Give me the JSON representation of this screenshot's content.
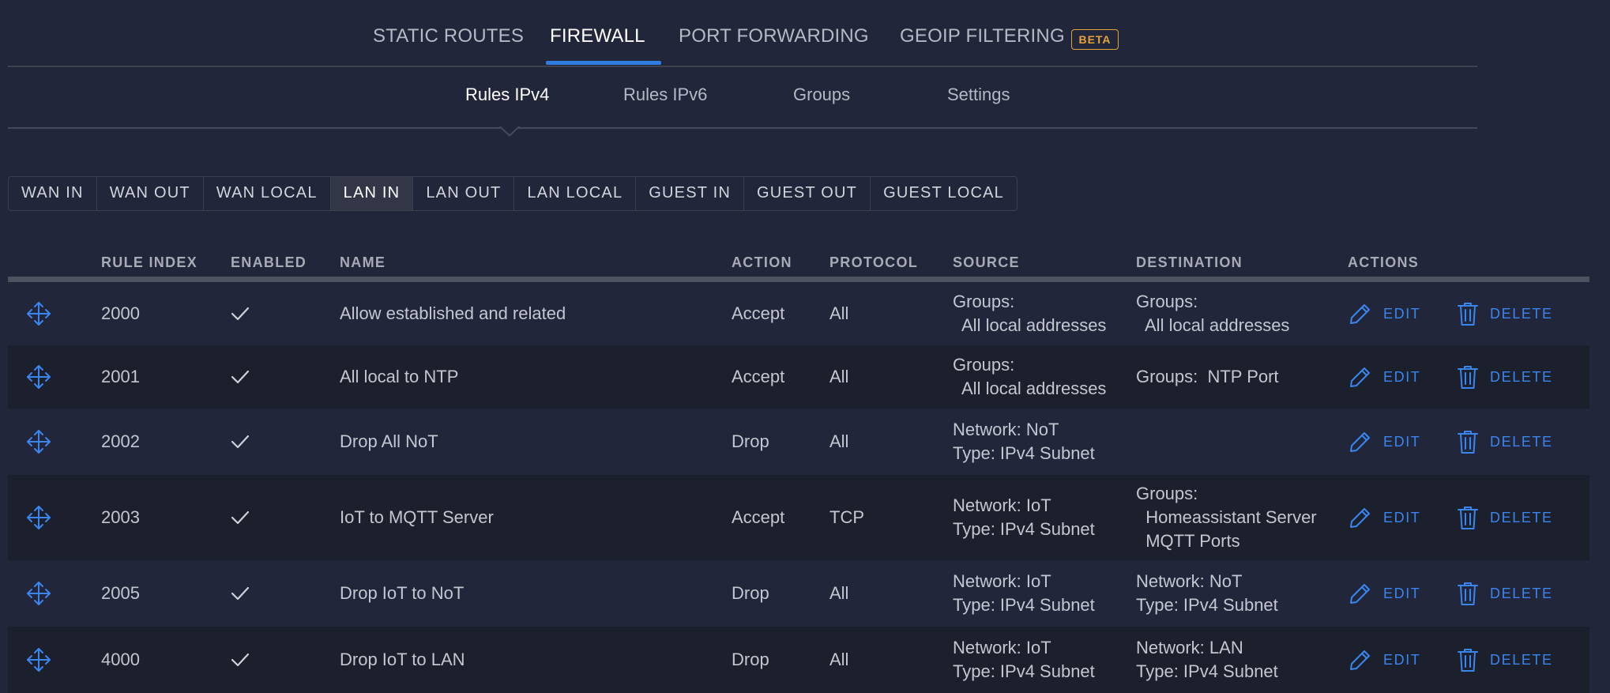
{
  "top_tabs": [
    {
      "label": "STATIC ROUTES",
      "active": false
    },
    {
      "label": "FIREWALL",
      "active": true
    },
    {
      "label": "PORT FORWARDING",
      "active": false
    },
    {
      "label": "GEOIP FILTERING",
      "active": false
    }
  ],
  "beta_badge": "BETA",
  "sub_tabs": [
    {
      "label": "Rules IPv4",
      "active": true
    },
    {
      "label": "Rules IPv6",
      "active": false
    },
    {
      "label": "Groups",
      "active": false
    },
    {
      "label": "Settings",
      "active": false
    }
  ],
  "rulesets": [
    "WAN IN",
    "WAN OUT",
    "WAN LOCAL",
    "LAN IN",
    "LAN OUT",
    "LAN LOCAL",
    "GUEST IN",
    "GUEST OUT",
    "GUEST LOCAL"
  ],
  "active_ruleset": "LAN IN",
  "columns": {
    "rule_index": "RULE INDEX",
    "enabled": "ENABLED",
    "name": "NAME",
    "action": "ACTION",
    "protocol": "PROTOCOL",
    "source": "SOURCE",
    "destination": "DESTINATION",
    "actions": "ACTIONS"
  },
  "action_labels": {
    "edit": "EDIT",
    "delete": "DELETE"
  },
  "rules": [
    {
      "index": "2000",
      "enabled": true,
      "name": "Allow established and related",
      "action": "Accept",
      "protocol": "All",
      "source": [
        "Groups:",
        "  All local addresses"
      ],
      "destination": [
        "Groups:",
        "  All local addresses"
      ]
    },
    {
      "index": "2001",
      "enabled": true,
      "name": "All local to NTP",
      "action": "Accept",
      "protocol": "All",
      "source": [
        "Groups:",
        "  All local addresses"
      ],
      "destination": [
        "Groups:  NTP Port"
      ]
    },
    {
      "index": "2002",
      "enabled": true,
      "name": "Drop All NoT",
      "action": "Drop",
      "protocol": "All",
      "source": [
        "Network: NoT",
        "Type: IPv4 Subnet"
      ],
      "destination": []
    },
    {
      "index": "2003",
      "enabled": true,
      "name": "IoT to MQTT Server",
      "action": "Accept",
      "protocol": "TCP",
      "source": [
        "Network: IoT",
        "Type: IPv4 Subnet"
      ],
      "destination": [
        "Groups:",
        "  Homeassistant Server",
        "  MQTT Ports"
      ]
    },
    {
      "index": "2005",
      "enabled": true,
      "name": "Drop IoT to NoT",
      "action": "Drop",
      "protocol": "All",
      "source": [
        "Network: IoT",
        "Type: IPv4 Subnet"
      ],
      "destination": [
        "Network: NoT",
        "Type: IPv4 Subnet"
      ]
    },
    {
      "index": "4000",
      "enabled": true,
      "name": "Drop IoT to LAN",
      "action": "Drop",
      "protocol": "All",
      "source": [
        "Network: IoT",
        "Type: IPv4 Subnet"
      ],
      "destination": [
        "Network: LAN",
        "Type: IPv4 Subnet"
      ]
    }
  ],
  "colors": {
    "accent": "#2f7de1",
    "link": "#3a86f0",
    "beta": "#e6a23a",
    "background": "#22263a"
  }
}
